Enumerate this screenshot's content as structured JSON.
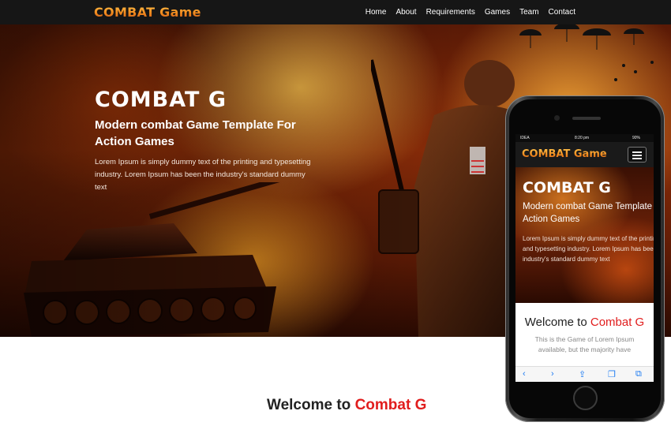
{
  "brand": {
    "logo": "COMBAT Game",
    "accent": "#f28a1e",
    "highlight": "#e11d1d"
  },
  "nav": {
    "items": [
      {
        "label": "Home"
      },
      {
        "label": "About"
      },
      {
        "label": "Requirements"
      },
      {
        "label": "Games"
      },
      {
        "label": "Team"
      },
      {
        "label": "Contact"
      }
    ]
  },
  "hero": {
    "title": "COMBAT G",
    "subtitle": "Modern combat Game Template For Action Games",
    "description": "Lorem Ipsum is simply dummy text of the printing and typesetting industry. Lorem Ipsum has been the industry's standard dummy text"
  },
  "welcome": {
    "prefix": "Welcome to",
    "highlight": "Combat G"
  },
  "phone": {
    "status": {
      "carrier": "IDEA",
      "time": "8:20 pm",
      "battery": "90%"
    },
    "logo": "COMBAT Game",
    "title": "COMBAT G",
    "subtitle_line1": "Modern combat Game Template Fo",
    "subtitle_line2": "Action Games",
    "desc_line1": "Lorem Ipsum is simply dummy text of the printing",
    "desc_line2": "and typesetting industry. Lorem Ipsum has been the",
    "desc_line3": "industry's standard dummy text",
    "welcome_prefix": "Welcome to",
    "welcome_highlight": "Combat G",
    "text_line1": "This is the Game of Lorem Ipsum",
    "text_line2": "available, but the majority have",
    "toolbar": {
      "back": "‹",
      "forward": "›",
      "share": "⇪",
      "bookmarks": "❐",
      "tabs": "⧉"
    }
  }
}
